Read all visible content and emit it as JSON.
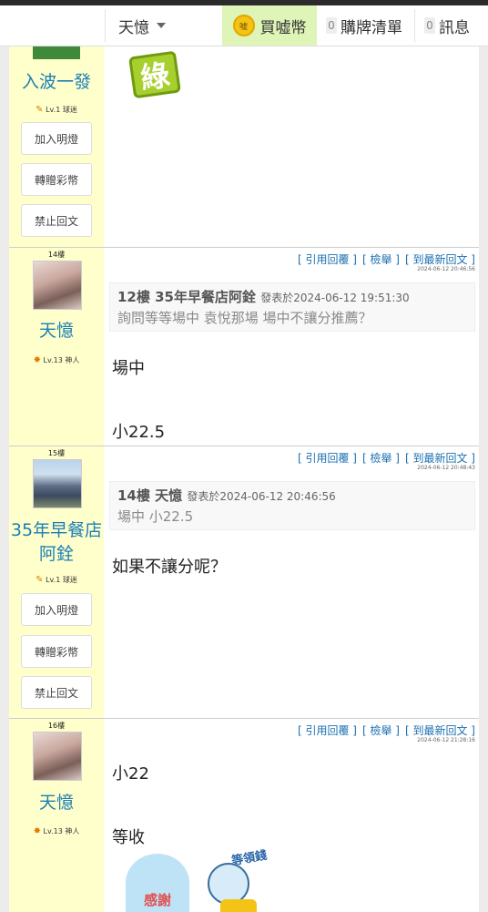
{
  "nav": {
    "user_menu": "天憶",
    "coin_label": "買嘘幣",
    "coin_icon_text": "嘘",
    "cart_count": "0",
    "cart_label": "購牌清單",
    "msg_count": "0",
    "msg_label": "訊息"
  },
  "links": {
    "quote": "[ 引用回覆 ]",
    "report": "[ 檢舉 ]",
    "latest": "[ 到最新回文 ]"
  },
  "post1": {
    "name": "入波一發",
    "level": "Lv.1 球迷",
    "buttons": [
      "加入明燈",
      "轉贈彩幣",
      "禁止回文"
    ],
    "sticker_text": "綠"
  },
  "post2": {
    "floor": "14樓",
    "name": "天憶",
    "level": "Lv.13 神人",
    "timestamp": "2024-06-12 20:46:56",
    "quote_header": "12樓 35年早餐店阿銓",
    "quote_meta": "發表於2024-06-12 19:51:30",
    "quote_body": "詢問等等場中 袁悅那場 場中不讓分推薦？",
    "lines": [
      "場中",
      "小22.5"
    ]
  },
  "post3": {
    "floor": "15樓",
    "name": "35年早餐店阿銓",
    "level": "Lv.1 球迷",
    "timestamp": "2024-06-12 20:48:43",
    "quote_header": "14樓 天憶",
    "quote_meta": "發表於2024-06-12 20:46:56",
    "quote_body": "場中 小22.5",
    "lines": [
      "如果不讓分呢？"
    ],
    "buttons": [
      "加入明燈",
      "轉贈彩幣",
      "禁止回文"
    ]
  },
  "post4": {
    "floor": "16樓",
    "name": "天憶",
    "level": "Lv.13 神人",
    "timestamp": "2024-06-12 21:28:16",
    "lines": [
      "小22",
      "等收"
    ],
    "sticker_labels": [
      "感謝",
      "等領錢"
    ]
  }
}
